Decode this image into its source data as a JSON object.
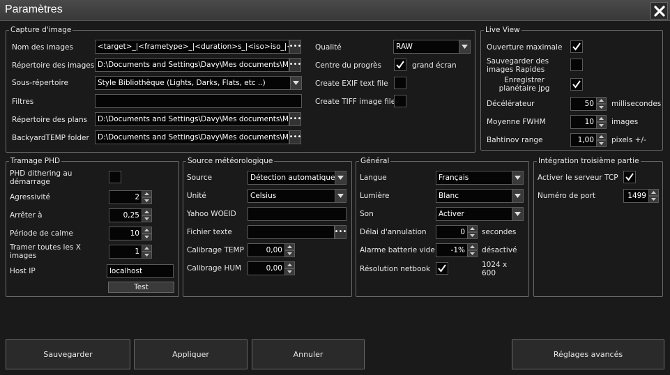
{
  "window": {
    "title": "Paramètres"
  },
  "capture": {
    "legend": "Capture d'image",
    "nom_label": "Nom des images",
    "nom_value": "<target>_|<frametype>_|<duration>s_|<iso>iso_|<...",
    "rep_label": "Répertoire des images",
    "rep_value": "D:\\Documents and Settings\\Davy\\Mes documents\\Mes...",
    "sousrep_label": "Sous-répertoire",
    "sousrep_value": "Style Bibliothèque (Lights, Darks, Flats, etc ..)",
    "filtres_label": "Filtres",
    "filtres_value": "",
    "plans_label": "Répertoire des plans",
    "plans_value": "D:\\Documents and Settings\\Davy\\Mes documents\\Mes...",
    "temp_label": "BackyardTEMP folder",
    "temp_value": "D:\\Documents and Settings\\Davy\\Mes documents\\Mes...",
    "qualite_label": "Qualité",
    "qualite_value": "RAW",
    "centre_label": "Centre du progrès",
    "centre_checked": true,
    "grand_ecran": "grand écran",
    "exif_label": "Create EXIF text file",
    "exif_checked": false,
    "tiff_label": "Create TIFF image file",
    "tiff_checked": false
  },
  "liveview": {
    "legend": "Live View",
    "ouverture_label": "Ouverture maximale",
    "ouverture_checked": true,
    "sauver_label": "Sauvegarder des images Rapides",
    "sauver_checked": false,
    "planetaire_label": "Enregistrer planétaire jpg",
    "planetaire_checked": true,
    "decel_label": "Décélérateur",
    "decel_value": "50",
    "decel_unit": "millisecondes",
    "fwhm_label": "Moyenne FWHM",
    "fwhm_value": "10",
    "fwhm_unit": "images",
    "bahtinov_label": "Bahtinov range",
    "bahtinov_value": "1,00",
    "bahtinov_unit": "pixels +/-"
  },
  "phd": {
    "legend": "Tramage PHD",
    "dither_label": "PHD dithering au démarrage",
    "dither_checked": false,
    "agress_label": "Agressivité",
    "agress_value": "2",
    "arreter_label": "Arrêter à",
    "arreter_value": "0,25",
    "calme_label": "Période de calme",
    "calme_value": "10",
    "tramer_label": "Tramer toutes les X images",
    "tramer_value": "1",
    "host_label": "Host IP",
    "host_value": "localhost",
    "test_label": "Test"
  },
  "meteo": {
    "legend": "Source météorologique",
    "source_label": "Source",
    "source_value": "Détection automatique",
    "unite_label": "Unité",
    "unite_value": "Celsius",
    "woeid_label": "Yahoo WOEID",
    "woeid_value": "",
    "fichier_label": "Fichier texte",
    "fichier_value": "",
    "ctemp_label": "Calibrage TEMP",
    "ctemp_value": "0,00",
    "chum_label": "Calibrage HUM",
    "chum_value": "0,00"
  },
  "general": {
    "legend": "Général",
    "langue_label": "Langue",
    "langue_value": "Français",
    "lumiere_label": "Lumière",
    "lumiere_value": "Blanc",
    "son_label": "Son",
    "son_value": "Activer",
    "delai_label": "Délai d'annulation",
    "delai_value": "0",
    "delai_unit": "secondes",
    "alarme_label": "Alarme batterie vide",
    "alarme_value": "-1%",
    "alarme_unit": "désactivé",
    "netbook_label": "Résolution netbook",
    "netbook_checked": true,
    "netbook_res": "1024 x 600"
  },
  "integration": {
    "legend": "Intégration troisième partie",
    "tcp_label": "Activer le serveur TCP",
    "tcp_checked": true,
    "port_label": "Numéro de port",
    "port_value": "1499"
  },
  "buttons": {
    "save": "Sauvegarder",
    "apply": "Appliquer",
    "cancel": "Annuler",
    "advanced": "Réglages avancés"
  },
  "colors": {
    "background": "#1a1a1a",
    "border": "#6a6a6a",
    "field_bg": "#050505",
    "text": "#e8e8e8"
  }
}
